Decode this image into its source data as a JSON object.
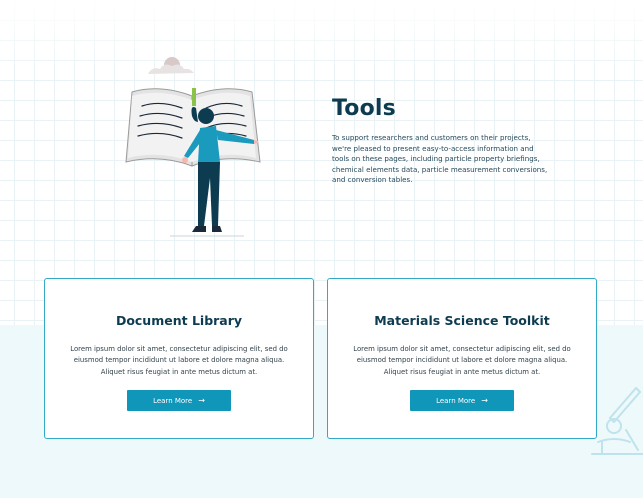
{
  "hero": {
    "title": "Tools",
    "description": "To support researchers and customers on their projects, we're pleased to present easy-to-access information and tools on these pages, including particle property briefings, chemical elements data, particle measurement conversions, and conversion tables."
  },
  "cards": [
    {
      "title": "Document Library",
      "body": "Lorem ipsum dolor sit amet, consectetur adipiscing elit, sed do eiusmod tempor incididunt ut labore et dolore magna aliqua. Aliquet risus feugiat in ante metus dictum at.",
      "button_label": "Learn More",
      "button_icon": "arrow-right-icon"
    },
    {
      "title": "Materials Science Toolkit",
      "body": "Lorem ipsum dolor sit amet, consectetur adipiscing elit, sed do eiusmod tempor incididunt ut labore et dolore magna aliqua. Aliquet risus feugiat in ante metus dictum at.",
      "button_label": "Learn More",
      "button_icon": "arrow-right-icon"
    }
  ],
  "colors": {
    "title": "#0d3b50",
    "accent": "#1096b9",
    "card_border": "#33a9c8",
    "lower_background": "#eef9fb"
  },
  "decorations": [
    "reading-woman-book-illustration",
    "microscope-icon"
  ]
}
